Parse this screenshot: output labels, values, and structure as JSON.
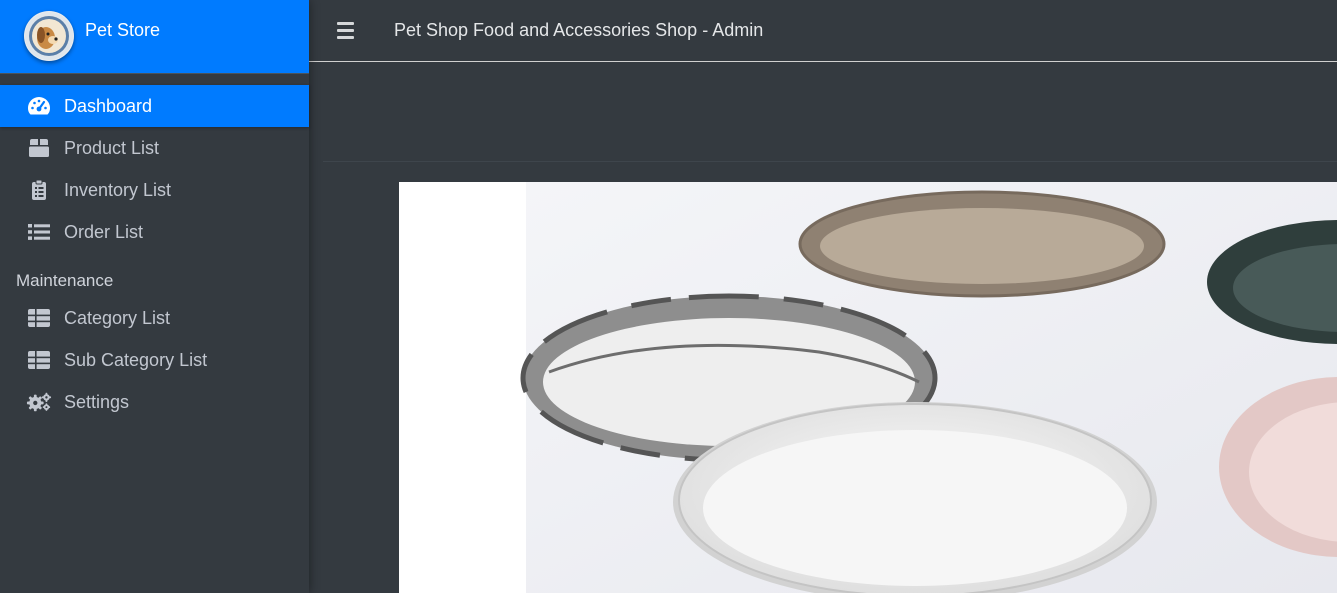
{
  "brand": {
    "name": "Pet Store",
    "logo": "pet-store-logo"
  },
  "sidebar": {
    "items": [
      {
        "label": "Dashboard",
        "icon": "tachometer-icon",
        "active": true
      },
      {
        "label": "Product List",
        "icon": "box-icon"
      },
      {
        "label": "Inventory List",
        "icon": "clipboard-list-icon"
      },
      {
        "label": "Order List",
        "icon": "list-icon"
      }
    ],
    "section_header": "Maintenance",
    "maintenance_items": [
      {
        "label": "Category List",
        "icon": "table-icon"
      },
      {
        "label": "Sub Category List",
        "icon": "table-icon"
      },
      {
        "label": "Settings",
        "icon": "cogs-icon"
      }
    ]
  },
  "topbar": {
    "title": "Pet Shop Food and Accessories Shop - Admin",
    "menu_icon": "hamburger-icon"
  },
  "colors": {
    "primary": "#007bff",
    "sidebar_bg": "#343a40",
    "text": "#c2c7d0"
  }
}
